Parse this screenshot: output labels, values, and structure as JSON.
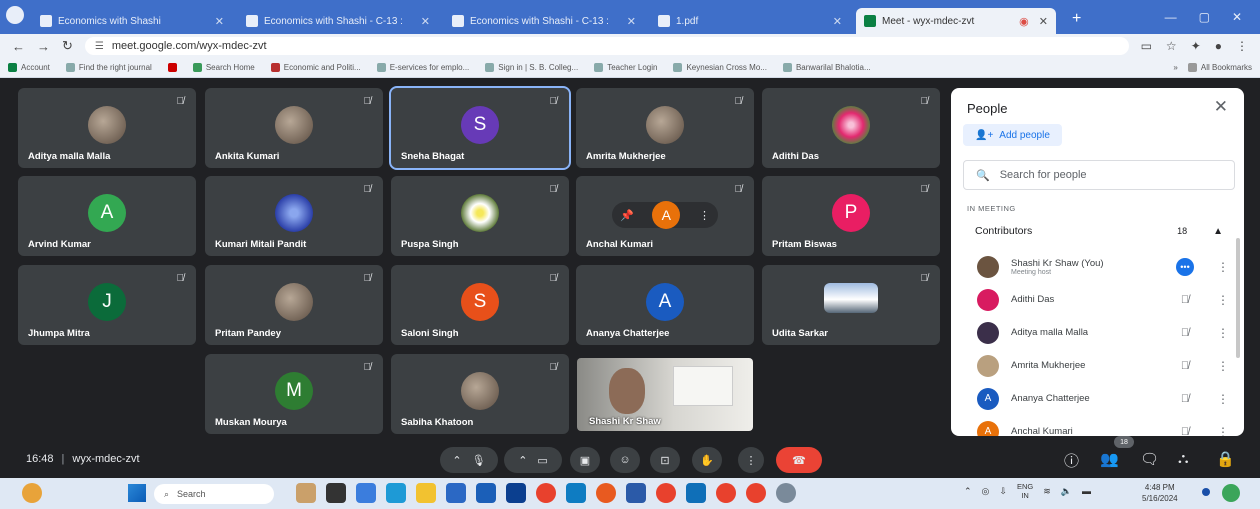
{
  "browser": {
    "tabs": [
      {
        "title": "Economics with Shashi",
        "active": false
      },
      {
        "title": "Economics with Shashi - C-13 :",
        "active": false
      },
      {
        "title": "Economics with Shashi - C-13 :",
        "active": false
      },
      {
        "title": "1.pdf",
        "active": false
      },
      {
        "title": "Meet - wyx-mdec-zvt",
        "active": true
      }
    ],
    "url": "meet.google.com/wyx-mdec-zvt",
    "bookmarks": [
      "Account",
      "Find the right journal",
      "Search Home",
      "Economic and Politi...",
      "E-services for emplo...",
      "Sign in | S. B. Colleg...",
      "Teacher Login",
      "Keynesian Cross Mo...",
      "Banwarilal Bhalotia..."
    ],
    "all_bookmarks": "All Bookmarks"
  },
  "meeting": {
    "time": "16:48",
    "code": "wyx-mdec-zvt",
    "participant_badge": "18",
    "tiles": [
      {
        "name": "Aditya malla Malla",
        "avatar": "photo"
      },
      {
        "name": "Ankita Kumari",
        "avatar": "photo"
      },
      {
        "name": "Sneha Bhagat",
        "initial": "S",
        "color": "#673ab7"
      },
      {
        "name": "Amrita Mukherjee",
        "avatar": "photo"
      },
      {
        "name": "Adithi Das",
        "avatar": "flower"
      },
      {
        "name": "Arvind Kumar",
        "initial": "A",
        "color": "#33a852"
      },
      {
        "name": "Kumari Mitali Pandit",
        "avatar": "blue"
      },
      {
        "name": "Puspa Singh",
        "avatar": "daisy"
      },
      {
        "name": "Anchal Kumari",
        "initial": "A",
        "color": "#e8710a"
      },
      {
        "name": "Pritam Biswas",
        "initial": "P",
        "color": "#e91e63"
      },
      {
        "name": "Jhumpa Mitra",
        "initial": "J",
        "color": "#0b6b3a"
      },
      {
        "name": "Pritam Pandey",
        "avatar": "photo"
      },
      {
        "name": "Saloni Singh",
        "initial": "S",
        "color": "#e8501a"
      },
      {
        "name": "Ananya Chatterjee",
        "initial": "A",
        "color": "#1a5bc0"
      },
      {
        "name": "Udita Sarkar",
        "avatar": "sky"
      },
      {
        "name": "Muskan Mourya",
        "initial": "M",
        "color": "#2e7d32"
      },
      {
        "name": "Sabiha Khatoon",
        "avatar": "photo"
      }
    ],
    "self_tile_name": "Shashi Kr Shaw"
  },
  "people_panel": {
    "title": "People",
    "add_people": "Add people",
    "search_placeholder": "Search for people",
    "section": "IN MEETING",
    "contributors_label": "Contributors",
    "contributors_count": "18",
    "people": [
      {
        "name": "Shashi Kr Shaw (You)",
        "sub": "Meeting host",
        "initial": "",
        "color": "#6b5440"
      },
      {
        "name": "Adithi Das",
        "sub": "",
        "initial": "",
        "color": "#d81b60"
      },
      {
        "name": "Aditya malla Malla",
        "sub": "",
        "initial": "",
        "color": "#3b2f4a"
      },
      {
        "name": "Amrita Mukherjee",
        "sub": "",
        "initial": "",
        "color": "#b9a07f"
      },
      {
        "name": "Ananya Chatterjee",
        "sub": "",
        "initial": "A",
        "color": "#1a5bc0"
      },
      {
        "name": "Anchal Kumari",
        "sub": "",
        "initial": "A",
        "color": "#e8710a"
      }
    ]
  },
  "taskbar": {
    "search": "Search",
    "lang_top": "ENG",
    "lang_bottom": "IN",
    "time": "4:48 PM",
    "date": "5/16/2024"
  }
}
